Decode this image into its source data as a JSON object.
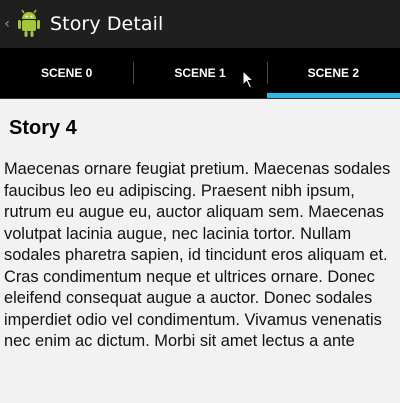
{
  "action_bar": {
    "title": "Story Detail",
    "up_icon": "chevron-left-icon",
    "app_icon": "android-icon"
  },
  "tabs": [
    {
      "label": "SCENE 0",
      "selected": false
    },
    {
      "label": "SCENE 1",
      "selected": false
    },
    {
      "label": "SCENE 2",
      "selected": true
    }
  ],
  "story": {
    "title": "Story 4",
    "body": "Maecenas ornare feugiat pretium. Maecenas sodales faucibus leo eu adipiscing. Praesent nibh ipsum, rutrum eu augue eu, auctor aliquam sem. Maecenas volutpat lacinia augue, nec lacinia tortor. Nullam sodales pharetra sapien, id tincidunt eros aliquam et. Cras condimentum neque et ultrices ornare. Donec eleifend consequat augue a auctor. Donec sodales imperdiet odio vel condimentum. Vivamus venenatis nec enim ac dictum. Morbi sit amet lectus a ante"
  },
  "colors": {
    "action_bar_bg": "#1f1f1f",
    "tab_bar_bg": "#000000",
    "tab_indicator": "#33b5e5",
    "content_bg": "#f2f2f2",
    "android_green": "#a4c639"
  }
}
